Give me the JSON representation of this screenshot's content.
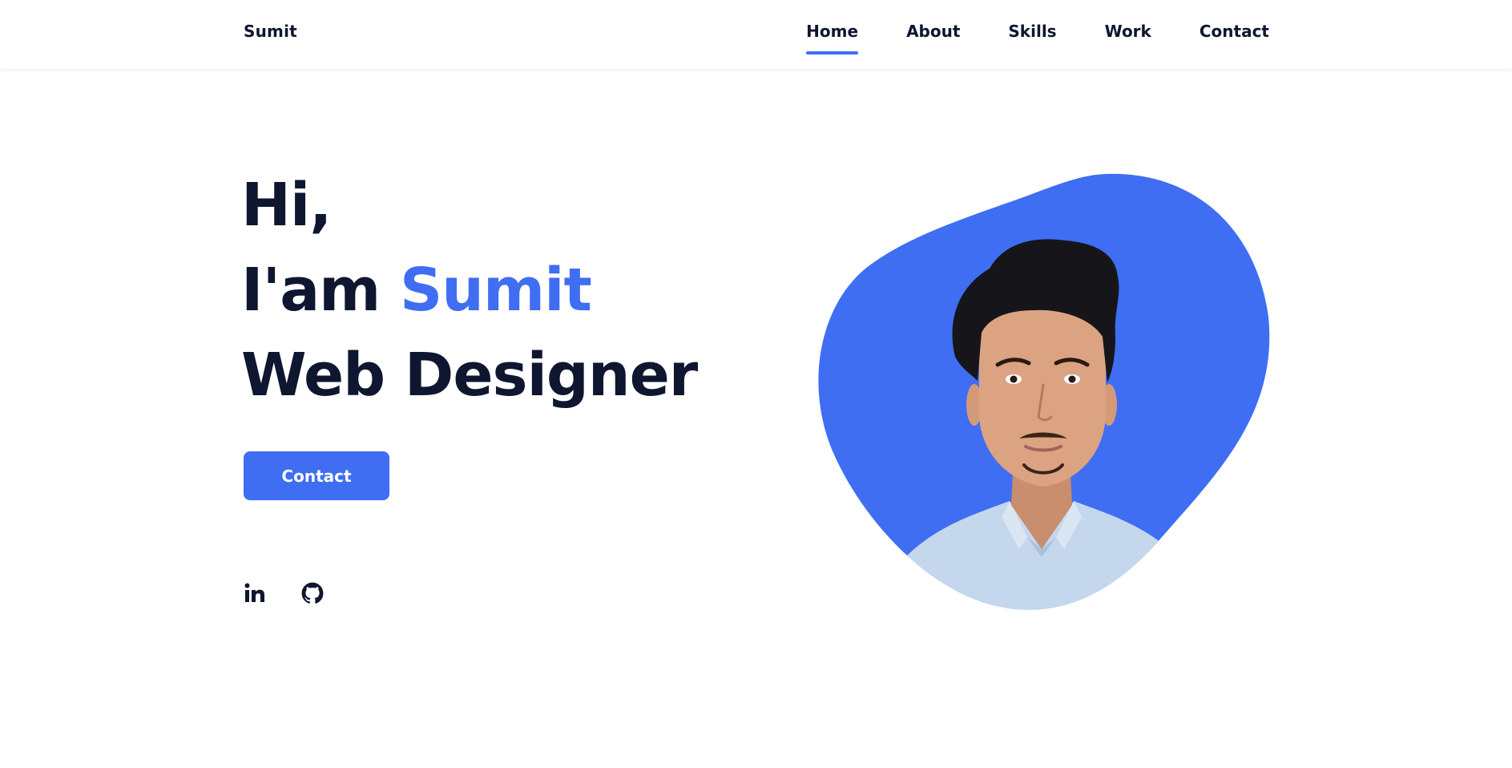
{
  "header": {
    "logo": "Sumit",
    "nav": [
      {
        "label": "Home",
        "active": true
      },
      {
        "label": "About",
        "active": false
      },
      {
        "label": "Skills",
        "active": false
      },
      {
        "label": "Work",
        "active": false
      },
      {
        "label": "Contact",
        "active": false
      }
    ]
  },
  "hero": {
    "greeting": "Hi,",
    "intro": "I'am ",
    "name": "Sumit",
    "role": "Web Designer",
    "cta_label": "Contact"
  },
  "social": [
    {
      "icon": "linkedin-icon"
    },
    {
      "icon": "github-icon"
    }
  ],
  "colors": {
    "accent": "#3f6ef3",
    "text": "#0e1630",
    "background": "#ffffff"
  }
}
